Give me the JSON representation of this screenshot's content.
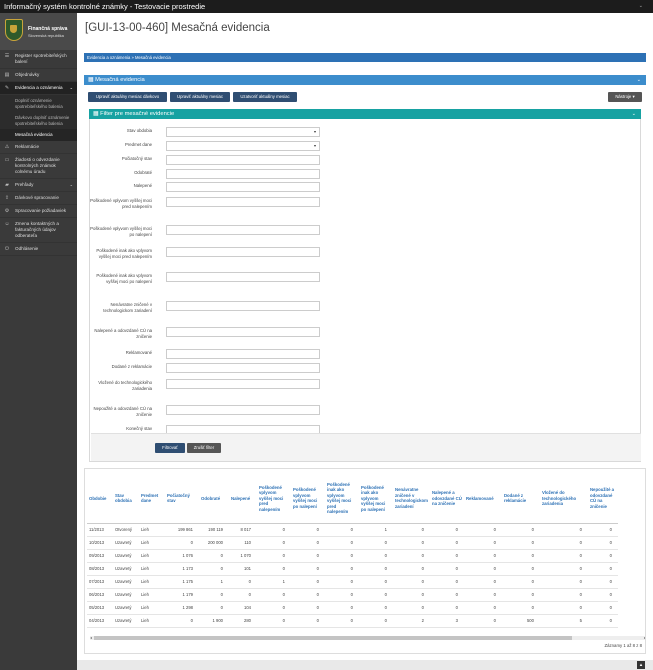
{
  "app_title": "Informačný systém kontrolné známky - Testovacie prostredie",
  "logo": {
    "line1": "Finančná správa",
    "line2": "Slovenská republika"
  },
  "sidebar": {
    "items": [
      {
        "label": "Register spotrebiteľských balení",
        "icon": "list-icon"
      },
      {
        "label": "Objednávky",
        "icon": "cart-icon"
      },
      {
        "label": "Evidencia a oznámenia",
        "icon": "edit-icon",
        "active": true
      },
      {
        "label": "Reklamácie",
        "icon": "warning-icon"
      },
      {
        "label": "Žiadosti o odvezdanie kontrolných známok colnému úradu",
        "icon": "truck-icon"
      },
      {
        "label": "Prehľady",
        "icon": "folder-icon"
      },
      {
        "label": "Dávkové spracovanie",
        "icon": "upload-icon"
      },
      {
        "label": "Spracovanie požiadaviek",
        "icon": "gear-icon"
      },
      {
        "label": "Zmena kontaktných a fakturačných údajov odberateľa",
        "icon": "user-icon"
      },
      {
        "label": "Odhlásenie",
        "icon": "logout-icon"
      }
    ],
    "subitems": [
      "Doplniť oznámenie spotrebiteľského balenia",
      "Dávkovo doplniť oznámenie spotrebiteľského balenia",
      "Mesačná evidencia"
    ]
  },
  "page_title": "[GUI-13-00-460] Mesačná evidencia",
  "breadcrumb": "Evidencia a oznámenia  »  Mesačná evidencia",
  "panel_title": "Mesačná evidencia",
  "buttons": {
    "edit_current": "Upraviť aktuálny mesiac dávkovo",
    "edit_month": "Upraviť aktuálny mesiac",
    "close_month": "Uzatvoriť aktuálny mesiac",
    "tools": "Nástroje ▾"
  },
  "filter": {
    "title": "Filter pre mesačné evidencie",
    "fields": [
      {
        "label": "Stav obdobia",
        "type": "select"
      },
      {
        "label": "Predmet dane",
        "type": "select"
      },
      {
        "label": "Počiatočný stav",
        "type": "text"
      },
      {
        "label": "Odobraté",
        "type": "text"
      },
      {
        "label": "Nalepené",
        "type": "text"
      },
      {
        "label": "Poškodené vplyvom vyššej moci pred nalepením",
        "type": "text"
      },
      {
        "label": "Poškodené vplyvom vyššej moci po nalepení",
        "type": "text"
      },
      {
        "label": "Poškodené inak ako vplyvom vyššej moci pred nalepením",
        "type": "text"
      },
      {
        "label": "Poškodené inak ako vplyvom vyššej moci po nalepení",
        "type": "text"
      },
      {
        "label": "Nenávratne zničené v technologickom zariadení",
        "type": "text"
      },
      {
        "label": "Nalepené a odovzdané CÚ na zničenie",
        "type": "text"
      },
      {
        "label": "Reklamované",
        "type": "text"
      },
      {
        "label": "Dodané z reklamácie",
        "type": "text"
      },
      {
        "label": "Vložené do technologického zariadenia",
        "type": "text"
      },
      {
        "label": "Nepoužité a odovzdané CÚ na zničenie",
        "type": "text"
      },
      {
        "label": "Konečný stav",
        "type": "text"
      }
    ],
    "submit": "Filtrovať",
    "reset": "Zrušiť filter"
  },
  "table": {
    "columns": [
      "Obdobie",
      "Stav obdobia",
      "Predmet dane",
      "Počiatočný stav",
      "Odobraté",
      "Nalepené",
      "Poškodené vplyvom vyššej moci pred nalepením",
      "Poškodené vplyvom vyššej moci po nalepení",
      "Poškodené inak ako vplyvom vyššej moci pred nalepením",
      "Poškodené inak ako vplyvom vyššej moci po nalepení",
      "Nenávratne zničené v technologickom zariadení",
      "Nalepené a odovzdané CÚ na zničenie",
      "Reklamované",
      "Dodané z reklamácie",
      "Vložené do technologického zariadenia",
      "Nepoužité a odovzdané CÚ na zničenie"
    ],
    "rows": [
      [
        "11/2013",
        "Otvorený",
        "Lieh",
        "199 861",
        "190 119",
        "8 017",
        "0",
        "0",
        "0",
        "1",
        "0",
        "0",
        "0",
        "0",
        "0",
        "0"
      ],
      [
        "10/2013",
        "Uzavretý",
        "Lieh",
        "0",
        "200 000",
        "110",
        "0",
        "0",
        "0",
        "0",
        "0",
        "0",
        "0",
        "0",
        "0",
        "0"
      ],
      [
        "09/2013",
        "Uzavretý",
        "Lieh",
        "1 076",
        "0",
        "1 070",
        "0",
        "0",
        "0",
        "0",
        "0",
        "0",
        "0",
        "0",
        "0",
        "0"
      ],
      [
        "08/2013",
        "Uzavretý",
        "Lieh",
        "1 173",
        "0",
        "101",
        "0",
        "0",
        "0",
        "0",
        "0",
        "0",
        "0",
        "0",
        "0",
        "0"
      ],
      [
        "07/2013",
        "Uzavretý",
        "Lieh",
        "1 175",
        "1",
        "0",
        "1",
        "0",
        "0",
        "0",
        "0",
        "0",
        "0",
        "0",
        "0",
        "0"
      ],
      [
        "06/2013",
        "Uzavretý",
        "Lieh",
        "1 179",
        "0",
        "0",
        "0",
        "0",
        "0",
        "0",
        "0",
        "0",
        "0",
        "0",
        "0",
        "0"
      ],
      [
        "05/2013",
        "Uzavretý",
        "Lieh",
        "1 298",
        "0",
        "104",
        "0",
        "0",
        "0",
        "0",
        "0",
        "0",
        "0",
        "0",
        "0",
        "0"
      ],
      [
        "04/2013",
        "Uzavretý",
        "Lieh",
        "0",
        "1 900",
        "280",
        "0",
        "0",
        "0",
        "0",
        "2",
        "3",
        "0",
        "500",
        "5",
        "0"
      ]
    ]
  },
  "records_info": "Záznamy 1 až 8 z 8"
}
